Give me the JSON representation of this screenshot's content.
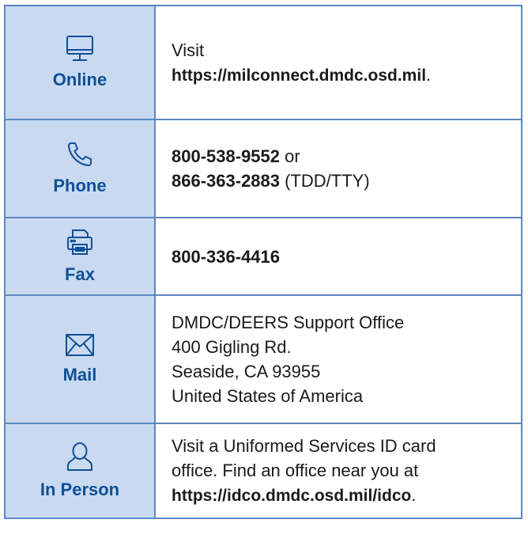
{
  "rows": {
    "online": {
      "icon": "monitor-icon",
      "label": "Online",
      "line1": "Visit",
      "url": "https://milconnect.dmdc.osd.mil",
      "url_suffix": "."
    },
    "phone": {
      "icon": "phone-icon",
      "label": "Phone",
      "number1": "800-538-9552",
      "connector": " or",
      "number2": "866-363-2883",
      "number2_note": " (TDD/TTY)"
    },
    "fax": {
      "icon": "fax-icon",
      "label": "Fax",
      "number": "800-336-4416"
    },
    "mail": {
      "icon": "envelope-icon",
      "label": "Mail",
      "address": [
        "DMDC/DEERS Support Office",
        "400 Gigling Rd.",
        "Seaside, CA 93955",
        "United States of America"
      ]
    },
    "in_person": {
      "icon": "person-icon",
      "label": "In Person",
      "line1": "Visit a Uniformed Services ID card",
      "line2": "office. Find an office near you at",
      "url": "https://idco.dmdc.osd.mil/idco",
      "url_suffix": "."
    }
  },
  "colors": {
    "border": "#5b87c4",
    "label_bg": "#c9daf0",
    "label_text": "#0e4f97",
    "icon_stroke": "#0e4f97"
  }
}
